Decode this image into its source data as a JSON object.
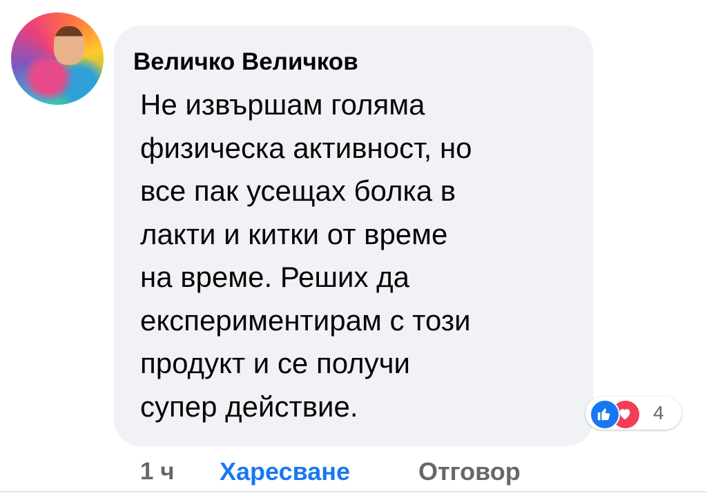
{
  "comment": {
    "author": "Величко Величков",
    "lines": [
      "Не извършам голяма",
      "физическа активност, но",
      "все пак усещах болка в",
      "лакти и китки от време",
      "на време. Реших да",
      "експериментирам с този",
      "продукт и се получи",
      "супер действие."
    ],
    "reactions": {
      "icons": [
        "like-icon",
        "love-icon"
      ],
      "count": "4",
      "like_color": "#1877f2",
      "love_color": "#f33e58"
    }
  },
  "actions": {
    "time": "1 ч",
    "like_label": "Харесване",
    "reply_label": "Отговор"
  },
  "colors": {
    "bubble": "#f0f2f5",
    "link": "#1877f2",
    "secondary_text": "#65676b"
  }
}
